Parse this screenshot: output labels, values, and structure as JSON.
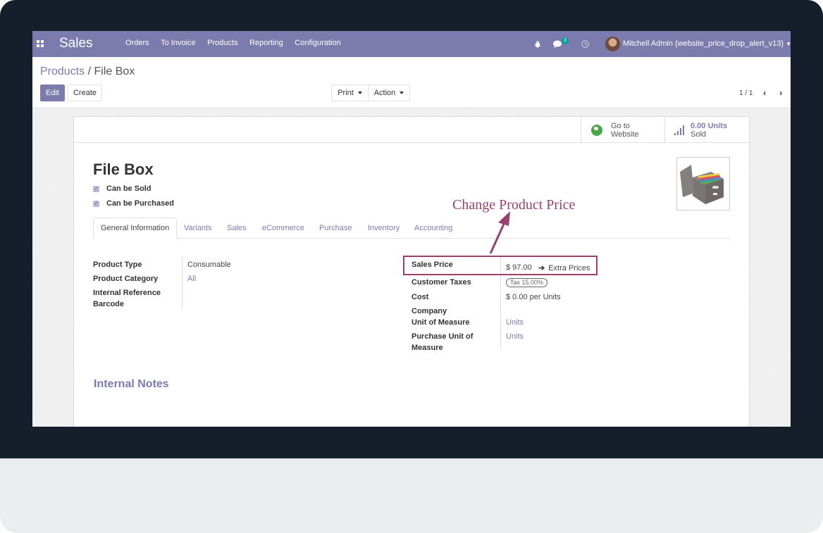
{
  "navbar": {
    "app_name": "Sales",
    "menu": [
      "Orders",
      "To Invoice",
      "Products",
      "Reporting",
      "Configuration"
    ],
    "icons": [
      "bug-icon",
      "chat-icon",
      "clock-icon"
    ],
    "chat_count": "3",
    "user": "Mitchell Admin (website_price_drop_alert_v13)"
  },
  "breadcrumb": {
    "parent": "Products",
    "separator": " / ",
    "current": "File Box"
  },
  "toolbar": {
    "edit_label": "Edit",
    "create_label": "Create",
    "print_label": "Print",
    "action_label": "Action",
    "pager": "1 / 1"
  },
  "smart_buttons": {
    "website_line1": "Go to",
    "website_line2": "Website",
    "sold_value": "0.00 Units",
    "sold_label": "Sold"
  },
  "product": {
    "name": "File Box",
    "can_be_sold_label": "Can be Sold",
    "can_be_sold": true,
    "can_be_purchased_label": "Can be Purchased",
    "can_be_purchased": true
  },
  "tabs": [
    "General Information",
    "Variants",
    "Sales",
    "eCommerce",
    "Purchase",
    "Inventory",
    "Accounting"
  ],
  "active_tab": "General Information",
  "left_fields": [
    {
      "label": "Product Type",
      "value": "Consumable"
    },
    {
      "label": "Product Category",
      "value": "All"
    },
    {
      "label": "Internal Reference",
      "value": ""
    },
    {
      "label": "Barcode",
      "value": ""
    }
  ],
  "right_fields": {
    "sales_price_label": "Sales Price",
    "sales_price_value": "$ 97.00",
    "extra_prices_label": "Extra Prices",
    "customer_taxes_label": "Customer Taxes",
    "customer_taxes_value": "Tax 15.00%",
    "cost_label": "Cost",
    "cost_value": "$ 0.00 per Units",
    "company_label": "Company",
    "uom_label": "Unit of Measure",
    "uom_value": "Units",
    "purchase_uom_label_1": "Purchase Unit of",
    "purchase_uom_label_2": "Measure",
    "purchase_uom_value": "Units"
  },
  "notes_title": "Internal Notes",
  "annotation": {
    "text": "Change Product Price",
    "color": "#98406e"
  },
  "colors": {
    "primary": "#7c7bad",
    "bezel": "#151f2b",
    "highlight": "#9b3f6c"
  }
}
